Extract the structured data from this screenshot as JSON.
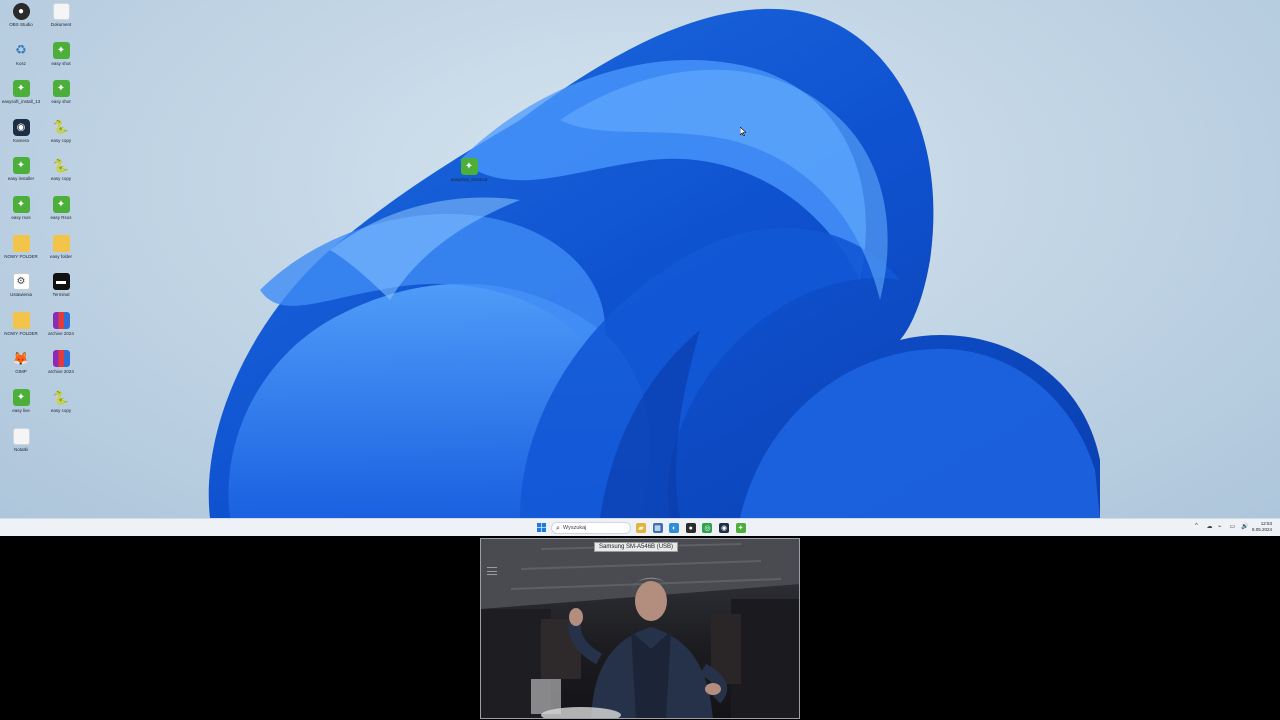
{
  "desktop": {
    "icons": [
      {
        "label": "OBS Studio",
        "glyph": "●",
        "style": "g-obs",
        "icon": "obs-icon"
      },
      {
        "label": "Dokument",
        "glyph": "",
        "style": "g-blank",
        "icon": "document-icon"
      },
      {
        "label": "Kosz",
        "glyph": "♻",
        "style": "g-recycle",
        "icon": "recycle-bin-icon"
      },
      {
        "label": "easy shot",
        "glyph": "✦",
        "style": "g-green",
        "icon": "easy-app-icon"
      },
      {
        "label": "easysoft_install_13",
        "glyph": "✦",
        "style": "g-green",
        "icon": "easy-app-icon"
      },
      {
        "label": "easy shot",
        "glyph": "✦",
        "style": "g-green",
        "icon": "easy-app-icon"
      },
      {
        "label": "Kamera",
        "glyph": "◉",
        "style": "g-cam",
        "icon": "camera-icon"
      },
      {
        "label": "easy copy",
        "glyph": "🐍",
        "style": "g-py",
        "icon": "python-file-icon"
      },
      {
        "label": "easy installer",
        "glyph": "✦",
        "style": "g-green",
        "icon": "easy-app-icon"
      },
      {
        "label": "easy copy",
        "glyph": "🐍",
        "style": "g-py",
        "icon": "python-file-icon"
      },
      {
        "label": "easy rsos",
        "glyph": "✦",
        "style": "g-green",
        "icon": "easy-app-icon"
      },
      {
        "label": "easy Rsos",
        "glyph": "✦",
        "style": "g-green",
        "icon": "easy-app-icon"
      },
      {
        "label": "NOWY FOLDER",
        "glyph": "",
        "style": "g-folder",
        "icon": "folder-icon"
      },
      {
        "label": "easy folder",
        "glyph": "",
        "style": "g-folder",
        "icon": "folder-icon"
      },
      {
        "label": "Ustawienia",
        "glyph": "⚙",
        "style": "g-doc",
        "icon": "settings-file-icon"
      },
      {
        "label": "Terminal",
        "glyph": "▬",
        "style": "g-dark",
        "icon": "terminal-icon"
      },
      {
        "label": "NOWY FOLDER",
        "glyph": "",
        "style": "g-folder",
        "icon": "folder-icon"
      },
      {
        "label": "archive 2024",
        "glyph": "",
        "style": "g-rar",
        "icon": "winrar-icon"
      },
      {
        "label": "GIMP",
        "glyph": "🦊",
        "style": "g-gimp",
        "icon": "gimp-icon"
      },
      {
        "label": "archive 2024",
        "glyph": "",
        "style": "g-rar",
        "icon": "winrar-icon"
      },
      {
        "label": "easy live",
        "glyph": "✦",
        "style": "g-green",
        "icon": "easy-app-icon"
      },
      {
        "label": "easy copy",
        "glyph": "🐍",
        "style": "g-py",
        "icon": "python-file-icon"
      },
      {
        "label": "Notatki",
        "glyph": "",
        "style": "g-blank",
        "icon": "document-icon"
      }
    ],
    "floating_icon": {
      "label": "easyshot_shortcut",
      "glyph": "✦",
      "style": "g-green",
      "icon": "easy-app-icon"
    }
  },
  "taskbar": {
    "search_placeholder": "Wyszukaj",
    "apps": [
      {
        "icon": "file-explorer-icon",
        "glyph": "▰",
        "color": "#e5b23a"
      },
      {
        "icon": "store-icon",
        "glyph": "▦",
        "color": "#3d6fb4"
      },
      {
        "icon": "edge-icon",
        "glyph": "◐",
        "color": "#2f8ed8"
      },
      {
        "icon": "obs-icon",
        "glyph": "●",
        "color": "#2b2b2b"
      },
      {
        "icon": "chrome-icon",
        "glyph": "◎",
        "color": "#2fa44f"
      },
      {
        "icon": "camera-icon",
        "glyph": "◉",
        "color": "#1e2f45"
      },
      {
        "icon": "easy-app-icon",
        "glyph": "✦",
        "color": "#4caf3a"
      }
    ],
    "tray": [
      "^",
      "☁",
      "⌁",
      "▭",
      "🔊"
    ],
    "clock_time": "12:53",
    "clock_date": "8.05.2024"
  },
  "webcam": {
    "device_label": "Samsung SM-A546B (USB)"
  }
}
